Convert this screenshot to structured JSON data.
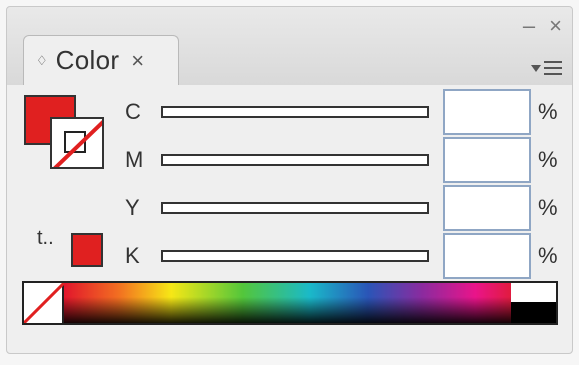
{
  "panel": {
    "tab_label": "Color",
    "updown_glyph": "♢",
    "close_glyph": "×",
    "minimize_glyph": "–",
    "window_close_glyph": "×"
  },
  "swatches": {
    "fill_color": "#e02020",
    "stroke": "none",
    "out_of_gamut_glyph": "t..",
    "gamut_color": "#e02020"
  },
  "channels": [
    {
      "label": "C",
      "value": "",
      "unit": "%"
    },
    {
      "label": "M",
      "value": "",
      "unit": "%"
    },
    {
      "label": "Y",
      "value": "",
      "unit": "%"
    },
    {
      "label": "K",
      "value": "",
      "unit": "%"
    }
  ],
  "spectrum": {
    "none_swatch": "none",
    "white": "#ffffff",
    "black": "#000000"
  }
}
